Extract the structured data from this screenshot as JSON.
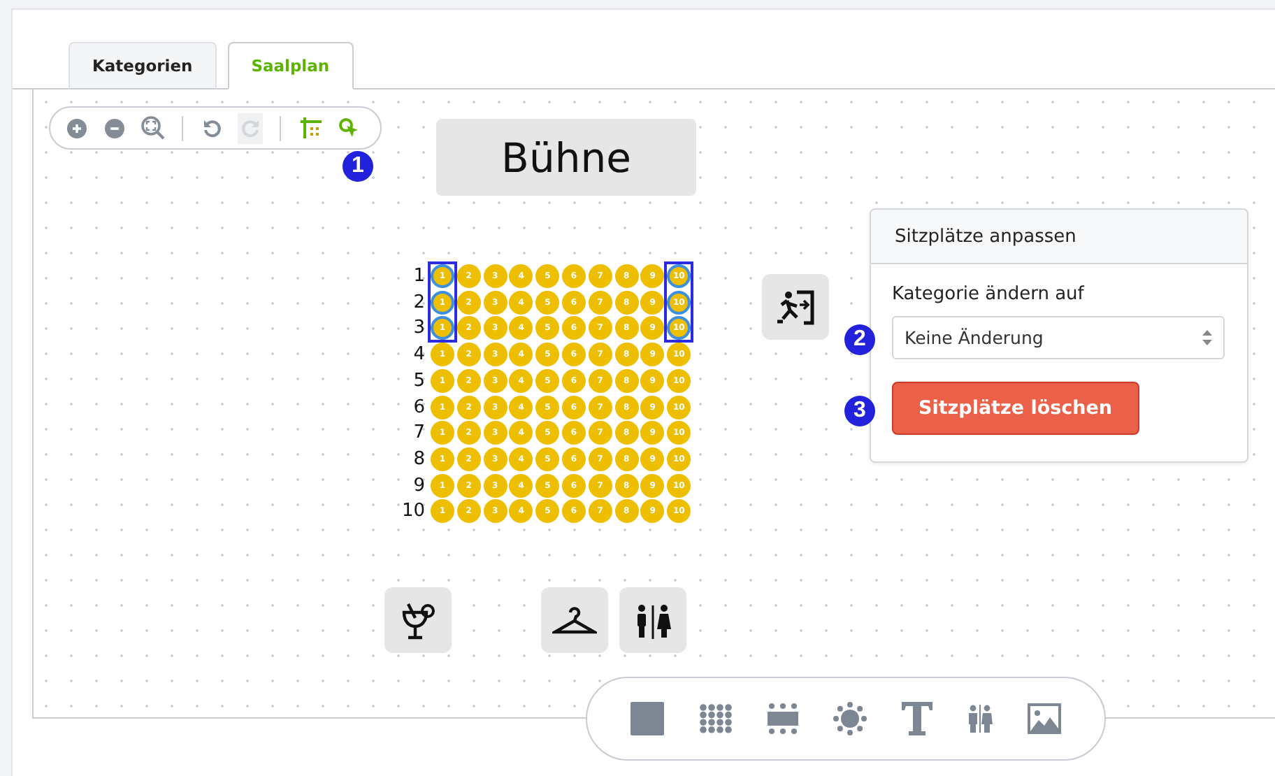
{
  "tabs": [
    {
      "label": "Kategorien",
      "selected": false
    },
    {
      "label": "Saalplan",
      "selected": true
    }
  ],
  "view_toolbar": [
    {
      "kind": "zoom-in",
      "active": false,
      "disabled": false
    },
    {
      "kind": "zoom-out",
      "active": false,
      "disabled": false
    },
    {
      "kind": "zoom-fit",
      "active": false,
      "disabled": false
    },
    {
      "kind": "undo",
      "active": false,
      "disabled": false
    },
    {
      "kind": "redo",
      "active": false,
      "disabled": true
    },
    {
      "kind": "grid",
      "active": true,
      "disabled": false
    },
    {
      "kind": "select",
      "active": true,
      "disabled": false
    }
  ],
  "stage": {
    "label": "Bühne"
  },
  "seat_rows": [
    {
      "label": "1",
      "seats": [
        {
          "label": "1",
          "selected": true
        },
        {
          "label": "2",
          "selected": false
        },
        {
          "label": "3",
          "selected": false
        },
        {
          "label": "4",
          "selected": false
        },
        {
          "label": "5",
          "selected": false
        },
        {
          "label": "6",
          "selected": false
        },
        {
          "label": "7",
          "selected": false
        },
        {
          "label": "8",
          "selected": false
        },
        {
          "label": "9",
          "selected": false
        },
        {
          "label": "10",
          "selected": true
        }
      ]
    },
    {
      "label": "2",
      "seats": [
        {
          "label": "1",
          "selected": true
        },
        {
          "label": "2",
          "selected": false
        },
        {
          "label": "3",
          "selected": false
        },
        {
          "label": "4",
          "selected": false
        },
        {
          "label": "5",
          "selected": false
        },
        {
          "label": "6",
          "selected": false
        },
        {
          "label": "7",
          "selected": false
        },
        {
          "label": "8",
          "selected": false
        },
        {
          "label": "9",
          "selected": false
        },
        {
          "label": "10",
          "selected": true
        }
      ]
    },
    {
      "label": "3",
      "seats": [
        {
          "label": "1",
          "selected": true
        },
        {
          "label": "2",
          "selected": false
        },
        {
          "label": "3",
          "selected": false
        },
        {
          "label": "4",
          "selected": false
        },
        {
          "label": "5",
          "selected": false
        },
        {
          "label": "6",
          "selected": false
        },
        {
          "label": "7",
          "selected": false
        },
        {
          "label": "8",
          "selected": false
        },
        {
          "label": "9",
          "selected": false
        },
        {
          "label": "10",
          "selected": true
        }
      ]
    },
    {
      "label": "4",
      "seats": [
        {
          "label": "1",
          "selected": false
        },
        {
          "label": "2",
          "selected": false
        },
        {
          "label": "3",
          "selected": false
        },
        {
          "label": "4",
          "selected": false
        },
        {
          "label": "5",
          "selected": false
        },
        {
          "label": "6",
          "selected": false
        },
        {
          "label": "7",
          "selected": false
        },
        {
          "label": "8",
          "selected": false
        },
        {
          "label": "9",
          "selected": false
        },
        {
          "label": "10",
          "selected": false
        }
      ]
    },
    {
      "label": "5",
      "seats": [
        {
          "label": "1",
          "selected": false
        },
        {
          "label": "2",
          "selected": false
        },
        {
          "label": "3",
          "selected": false
        },
        {
          "label": "4",
          "selected": false
        },
        {
          "label": "5",
          "selected": false
        },
        {
          "label": "6",
          "selected": false
        },
        {
          "label": "7",
          "selected": false
        },
        {
          "label": "8",
          "selected": false
        },
        {
          "label": "9",
          "selected": false
        },
        {
          "label": "10",
          "selected": false
        }
      ]
    },
    {
      "label": "6",
      "seats": [
        {
          "label": "1",
          "selected": false
        },
        {
          "label": "2",
          "selected": false
        },
        {
          "label": "3",
          "selected": false
        },
        {
          "label": "4",
          "selected": false
        },
        {
          "label": "5",
          "selected": false
        },
        {
          "label": "6",
          "selected": false
        },
        {
          "label": "7",
          "selected": false
        },
        {
          "label": "8",
          "selected": false
        },
        {
          "label": "9",
          "selected": false
        },
        {
          "label": "10",
          "selected": false
        }
      ]
    },
    {
      "label": "7",
      "seats": [
        {
          "label": "1",
          "selected": false
        },
        {
          "label": "2",
          "selected": false
        },
        {
          "label": "3",
          "selected": false
        },
        {
          "label": "4",
          "selected": false
        },
        {
          "label": "5",
          "selected": false
        },
        {
          "label": "6",
          "selected": false
        },
        {
          "label": "7",
          "selected": false
        },
        {
          "label": "8",
          "selected": false
        },
        {
          "label": "9",
          "selected": false
        },
        {
          "label": "10",
          "selected": false
        }
      ]
    },
    {
      "label": "8",
      "seats": [
        {
          "label": "1",
          "selected": false
        },
        {
          "label": "2",
          "selected": false
        },
        {
          "label": "3",
          "selected": false
        },
        {
          "label": "4",
          "selected": false
        },
        {
          "label": "5",
          "selected": false
        },
        {
          "label": "6",
          "selected": false
        },
        {
          "label": "7",
          "selected": false
        },
        {
          "label": "8",
          "selected": false
        },
        {
          "label": "9",
          "selected": false
        },
        {
          "label": "10",
          "selected": false
        }
      ]
    },
    {
      "label": "9",
      "seats": [
        {
          "label": "1",
          "selected": false
        },
        {
          "label": "2",
          "selected": false
        },
        {
          "label": "3",
          "selected": false
        },
        {
          "label": "4",
          "selected": false
        },
        {
          "label": "5",
          "selected": false
        },
        {
          "label": "6",
          "selected": false
        },
        {
          "label": "7",
          "selected": false
        },
        {
          "label": "8",
          "selected": false
        },
        {
          "label": "9",
          "selected": false
        },
        {
          "label": "10",
          "selected": false
        }
      ]
    },
    {
      "label": "10",
      "seats": [
        {
          "label": "1",
          "selected": false
        },
        {
          "label": "2",
          "selected": false
        },
        {
          "label": "3",
          "selected": false
        },
        {
          "label": "4",
          "selected": false
        },
        {
          "label": "5",
          "selected": false
        },
        {
          "label": "6",
          "selected": false
        },
        {
          "label": "7",
          "selected": false
        },
        {
          "label": "8",
          "selected": false
        },
        {
          "label": "9",
          "selected": false
        },
        {
          "label": "10",
          "selected": false
        }
      ]
    }
  ],
  "facilities": [
    {
      "kind": "exit"
    },
    {
      "kind": "bar"
    },
    {
      "kind": "cloakroom"
    },
    {
      "kind": "restroom"
    }
  ],
  "panel": {
    "title": "Sitzplätze anpassen",
    "field_label": "Kategorie ändern auf",
    "select_value": "Keine Änderung",
    "button": "Sitzplätze löschen"
  },
  "callouts": [
    "1",
    "2",
    "3"
  ],
  "element_toolbar": [
    {
      "kind": "block"
    },
    {
      "kind": "seat-grid"
    },
    {
      "kind": "table"
    },
    {
      "kind": "round-table"
    },
    {
      "kind": "text"
    },
    {
      "kind": "restroom"
    },
    {
      "kind": "image"
    }
  ]
}
